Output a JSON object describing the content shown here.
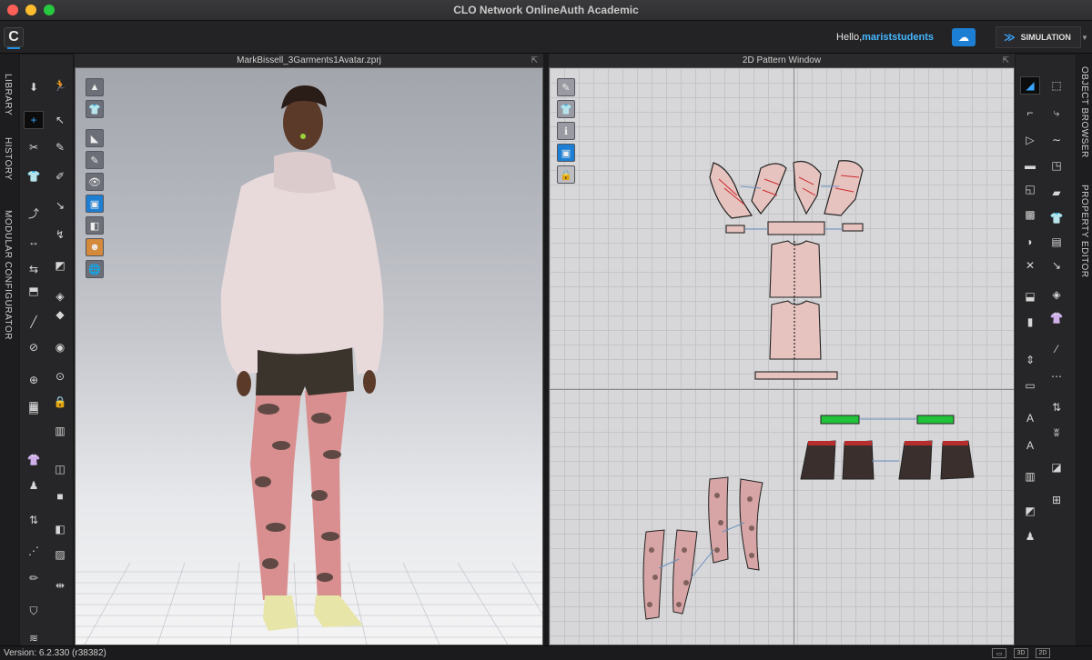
{
  "window": {
    "title": "CLO Network OnlineAuth Academic"
  },
  "app": {
    "logo_letter": "C"
  },
  "account": {
    "greeting": "Hello,",
    "username": "mariststudents"
  },
  "toolbar": {
    "simulation_label": "SIMULATION"
  },
  "left_tabs": [
    "LIBRARY",
    "HISTORY",
    "MODULAR CONFIGURATOR"
  ],
  "right_tabs": [
    "OBJECT BROWSER",
    "PROPERTY EDITOR"
  ],
  "view3d": {
    "title": "MarkBissell_3Garments1Avatar.zprj"
  },
  "view2d": {
    "title": "2D Pattern Window"
  },
  "status": {
    "version": "Version: 6.2.330 (r38382)"
  },
  "view_buttons": [
    "3D",
    "2D"
  ],
  "colors": {
    "accent": "#1e8fe0",
    "username": "#46b7ff",
    "pattern_pink": "#e6c3bf",
    "trim_green": "#22c33a",
    "dark_piece": "#3a2f2c"
  }
}
